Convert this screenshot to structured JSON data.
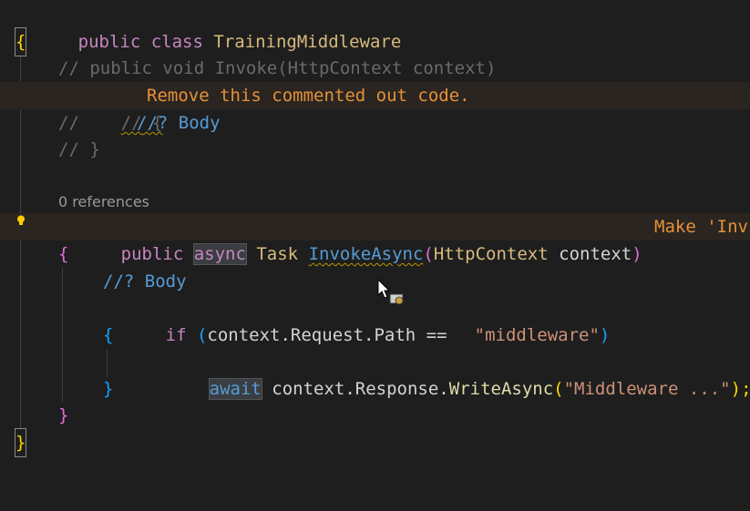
{
  "code": {
    "l1": {
      "kw": "public class ",
      "name": "TrainingMiddleware"
    },
    "l2": {
      "brace": "{"
    },
    "l3": {
      "comment": "// public void Invoke(HttpContext context)"
    },
    "l4": {
      "comment_a": "//",
      "comment_b": " {",
      "hint": "Remove this commented out code."
    },
    "l5": {
      "comment": "//     ",
      "body": "//? Body"
    },
    "l6": {
      "comment": "// }"
    },
    "refs": "0 references",
    "l8": {
      "public": "public ",
      "async": "async",
      "task": " Task ",
      "method": "InvokeAsync",
      "open": "(",
      "ptype": "HttpContext",
      "pname": " context",
      "close": ")",
      "hint": "Make 'Inv"
    },
    "l9": {
      "brace": "{"
    },
    "l10": {
      "body": "//? Body"
    },
    "l11": {
      "if": "if",
      "open": " (",
      "expr": "context.Request.Path ",
      "eq": "==",
      "str": "\"middleware\"",
      "close": ")"
    },
    "l12": {
      "brace": "{"
    },
    "l13": {
      "await": "await",
      "obj": " context.Response.",
      "method": "WriteAsync",
      "open": "(",
      "str": "\"Middleware ...\"",
      "close": ");"
    },
    "l14": {
      "brace": "}"
    },
    "l15": {
      "brace": "}"
    },
    "l16": {
      "brace": "}"
    }
  },
  "icons": {
    "lightbulb": "lightbulb-icon",
    "cursor": "mouse-cursor-icon"
  },
  "colors": {
    "background": "#1e1e1e",
    "keyword": "#c586c0",
    "type": "#d7ba7d",
    "string": "#ce9178",
    "warning": "#e69138"
  }
}
